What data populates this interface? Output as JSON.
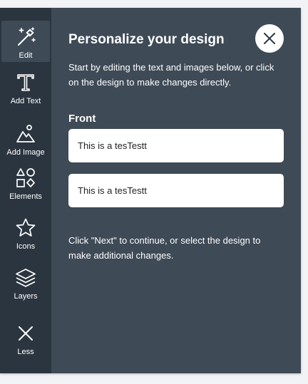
{
  "toolbar": {
    "items": [
      {
        "label": "Edit",
        "icon": "magic-wand-icon"
      },
      {
        "label": "Add Text",
        "icon": "text-t-icon"
      },
      {
        "label": "Add Image",
        "icon": "image-icon"
      },
      {
        "label": "Elements",
        "icon": "shapes-icon"
      },
      {
        "label": "Icons",
        "icon": "star-icon"
      },
      {
        "label": "Layers",
        "icon": "layers-icon"
      },
      {
        "label": "Less",
        "icon": "close-x-icon"
      }
    ]
  },
  "panel": {
    "title": "Personalize your design",
    "intro": "Start by editing the text and images below, or click on the design to make changes directly.",
    "section_label": "Front",
    "fields": [
      {
        "value": "This is a tesTestt"
      },
      {
        "value": "This is a tesTestt"
      }
    ],
    "outro": "Click \"Next\" to continue, or select the design to make additional changes."
  },
  "colors": {
    "page_background": "#f2f3f5",
    "panel_background": "#3e4a56",
    "toolbar_background": "#2a353f",
    "text": "#ffffff",
    "field_background": "#ffffff"
  }
}
